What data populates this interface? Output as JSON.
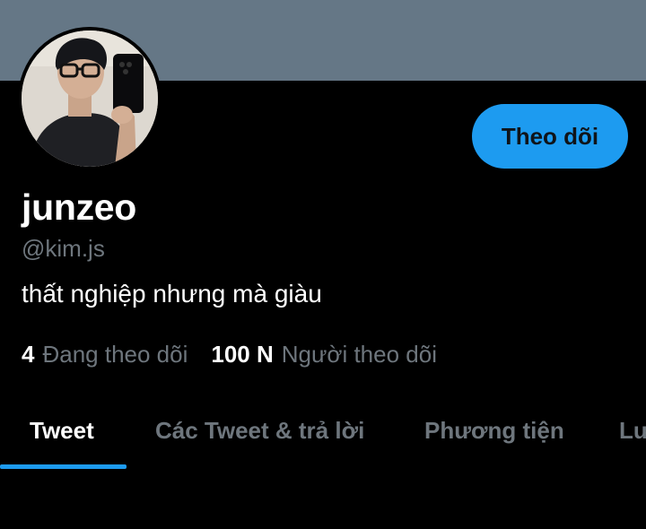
{
  "profile": {
    "display_name": "junzeo",
    "handle": "@kim.js",
    "bio": "thất nghiệp nhưng mà giàu",
    "follow_label": "Theo dõi"
  },
  "stats": {
    "following_count": "4",
    "following_label": "Đang theo dõi",
    "followers_count": "100 N",
    "followers_label": "Người theo dõi"
  },
  "tabs": [
    {
      "label": "Tweet",
      "active": true
    },
    {
      "label": "Các Tweet & trả lời",
      "active": false
    },
    {
      "label": "Phương tiện",
      "active": false
    },
    {
      "label": "Lượt thích",
      "active": false
    }
  ],
  "colors": {
    "background": "#000000",
    "banner": "#657786",
    "accent": "#1d9bf0",
    "secondary_text": "#6e767d"
  }
}
